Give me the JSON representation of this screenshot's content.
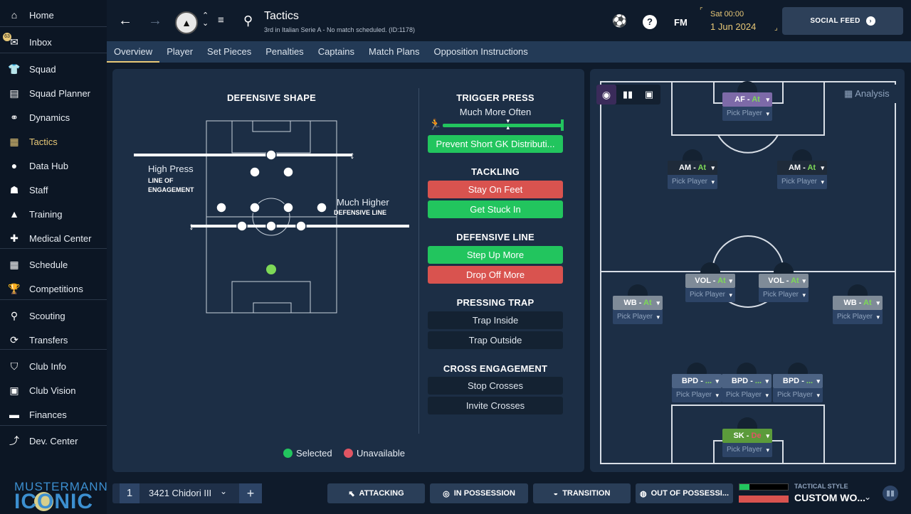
{
  "sidebar": {
    "items": [
      {
        "label": "Home",
        "icon": "home-icon",
        "glyph": "⌂"
      },
      {
        "label": "Inbox",
        "icon": "inbox-icon",
        "glyph": "✉"
      },
      {
        "label": "Squad",
        "icon": "shirt-icon",
        "glyph": "👕"
      },
      {
        "label": "Squad Planner",
        "icon": "clipboard-icon",
        "glyph": "▤"
      },
      {
        "label": "Dynamics",
        "icon": "dynamics-icon",
        "glyph": "⚭"
      },
      {
        "label": "Tactics",
        "icon": "tactics-icon",
        "glyph": "▦"
      },
      {
        "label": "Data Hub",
        "icon": "data-hub-icon",
        "glyph": "●"
      },
      {
        "label": "Staff",
        "icon": "staff-icon",
        "glyph": "☗"
      },
      {
        "label": "Training",
        "icon": "training-icon",
        "glyph": "▲"
      },
      {
        "label": "Medical Center",
        "icon": "medical-icon",
        "glyph": "✚"
      },
      {
        "label": "Schedule",
        "icon": "calendar-icon",
        "glyph": "▦"
      },
      {
        "label": "Competitions",
        "icon": "trophy-icon",
        "glyph": "🏆"
      },
      {
        "label": "Scouting",
        "icon": "search-icon",
        "glyph": "⚲"
      },
      {
        "label": "Transfers",
        "icon": "transfers-icon",
        "glyph": "⟳"
      },
      {
        "label": "Club Info",
        "icon": "shield-icon",
        "glyph": "⛉"
      },
      {
        "label": "Club Vision",
        "icon": "briefcase-icon",
        "glyph": "▣"
      },
      {
        "label": "Finances",
        "icon": "money-icon",
        "glyph": "▬"
      },
      {
        "label": "Dev. Center",
        "icon": "trend-icon",
        "glyph": "⤴"
      }
    ],
    "inbox_badge": "63",
    "logo_top": "MUSTERMANN",
    "logo_bottom": "ICONIC"
  },
  "header": {
    "title": "Tactics",
    "subtitle": "3rd in Italian Serie A - No match scheduled. (ID:1178)",
    "day": "Sat 00:00",
    "date": "1 Jun 2024",
    "fm": "FM",
    "social_label": "SOCIAL FEED",
    "accent": "#e8c877"
  },
  "tabs": [
    "Overview",
    "Player",
    "Set Pieces",
    "Penalties",
    "Captains",
    "Match Plans",
    "Opposition Instructions"
  ],
  "defensive": {
    "title": "DEFENSIVE SHAPE",
    "press_label": "High Press",
    "line_engagement": "LINE OF ENGAGEMENT",
    "line_label": "Much Higher",
    "def_line": "DEFENSIVE LINE",
    "legend_selected": "Selected",
    "legend_unavailable": "Unavailable"
  },
  "instructions": {
    "trigger_title": "TRIGGER PRESS",
    "trigger_value": "Much More Often",
    "trigger_level": 0.55,
    "prevent_gk": "Prevent Short GK Distributi...",
    "tackling_title": "TACKLING",
    "stay_on_feet": "Stay On Feet",
    "get_stuck_in": "Get Stuck In",
    "defline_title": "DEFENSIVE LINE",
    "step_up": "Step Up More",
    "drop_off": "Drop Off More",
    "trap_title": "PRESSING TRAP",
    "trap_inside": "Trap Inside",
    "trap_outside": "Trap Outside",
    "cross_title": "CROSS ENGAGEMENT",
    "stop_crosses": "Stop Crosses",
    "invite_crosses": "Invite Crosses"
  },
  "formation": {
    "analysis": "Analysis",
    "pick": "Pick Player",
    "positions": [
      {
        "role": "AF",
        "duty": "At",
        "color": "#7d6aa8"
      },
      {
        "role": "AM",
        "duty": "At",
        "color": "#1f2b3a"
      },
      {
        "role": "AM",
        "duty": "At",
        "color": "#1f2b3a"
      },
      {
        "role": "VOL",
        "duty": "At",
        "color": "#7f8b98"
      },
      {
        "role": "VOL",
        "duty": "At",
        "color": "#7f8b98"
      },
      {
        "role": "WB",
        "duty": "At",
        "color": "#7f8b98"
      },
      {
        "role": "WB",
        "duty": "At",
        "color": "#7f8b98"
      },
      {
        "role": "BPD",
        "duty": "...",
        "color": "#4c6384"
      },
      {
        "role": "BPD",
        "duty": "...",
        "color": "#4c6384"
      },
      {
        "role": "BPD",
        "duty": "...",
        "color": "#4c6384"
      },
      {
        "role": "SK",
        "duty": "De",
        "color": "#5b9b3b"
      }
    ]
  },
  "bottom": {
    "number": "1",
    "tactic_name": "3421 Chidori III",
    "attacking": "ATTACKING",
    "in_possession": "IN POSSESSION",
    "transition": "TRANSITION",
    "out_possession": "OUT OF POSSESSI...",
    "style_label": "TACTICAL STYLE",
    "style_value": "CUSTOM WO..."
  }
}
